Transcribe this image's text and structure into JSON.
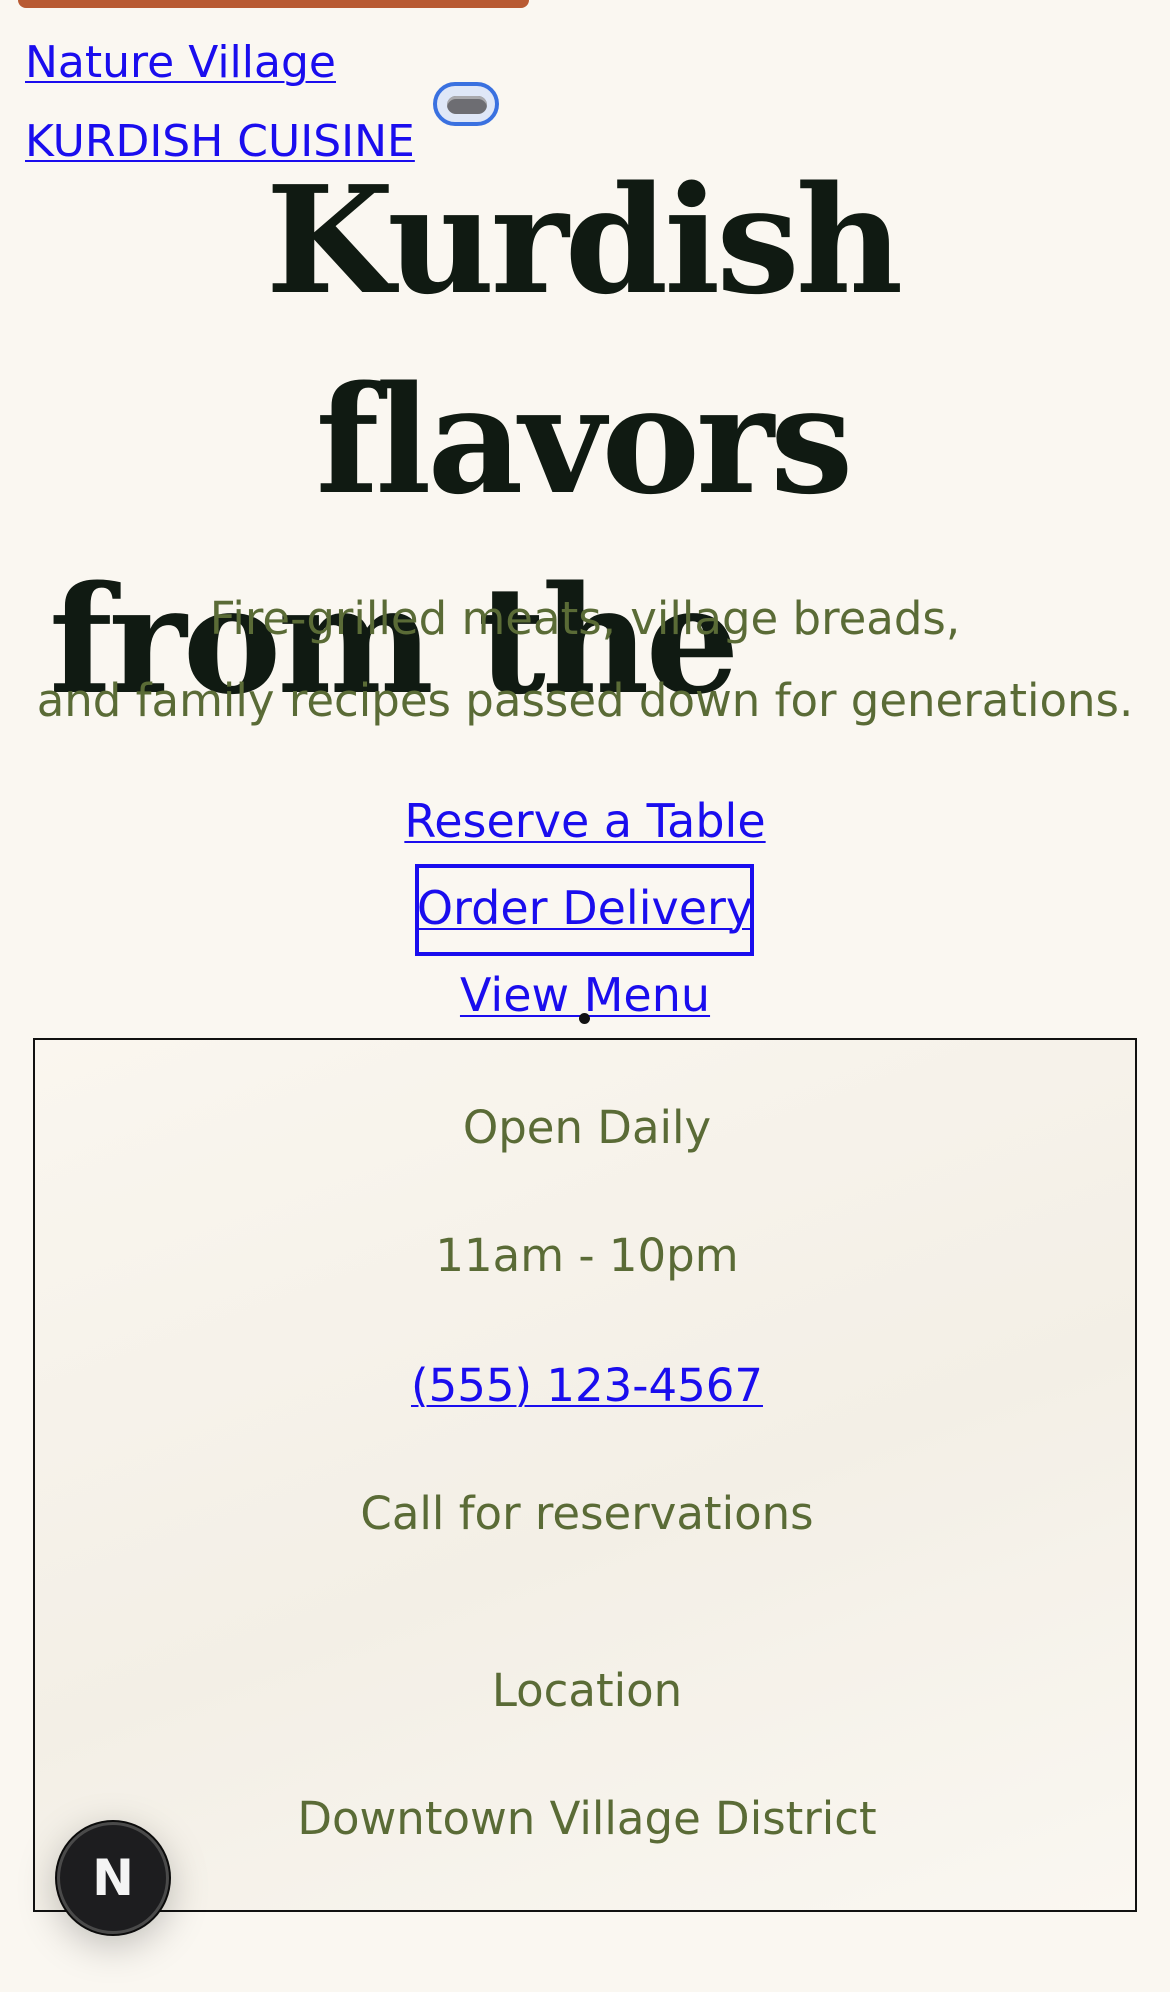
{
  "header": {
    "brand": "Nature Village",
    "tagline": "KURDISH CUISINE"
  },
  "hero": {
    "headline_line1": "Kurdish flavors",
    "headline_line2": "from the",
    "subtext_line1": "Fire-grilled meats, village breads,",
    "subtext_line2": "and family recipes passed down for generations."
  },
  "actions": {
    "reserve": "Reserve a Table",
    "order": "Order Delivery",
    "menu": "View Menu"
  },
  "info": {
    "open_label": "Open Daily",
    "hours": "11am - 10pm",
    "phone": "(555) 123-4567",
    "call_note": "Call for reservations",
    "location_label": "Location",
    "location_value": "Downtown Village District"
  },
  "dev_badge": {
    "letter": "N"
  },
  "colors": {
    "background": "#faf7f1",
    "accent_bar": "#b85a33",
    "link": "#1a0dee",
    "headline": "#101a12",
    "olive_text": "#5a6b36",
    "toggle_border": "#3a71e0"
  }
}
